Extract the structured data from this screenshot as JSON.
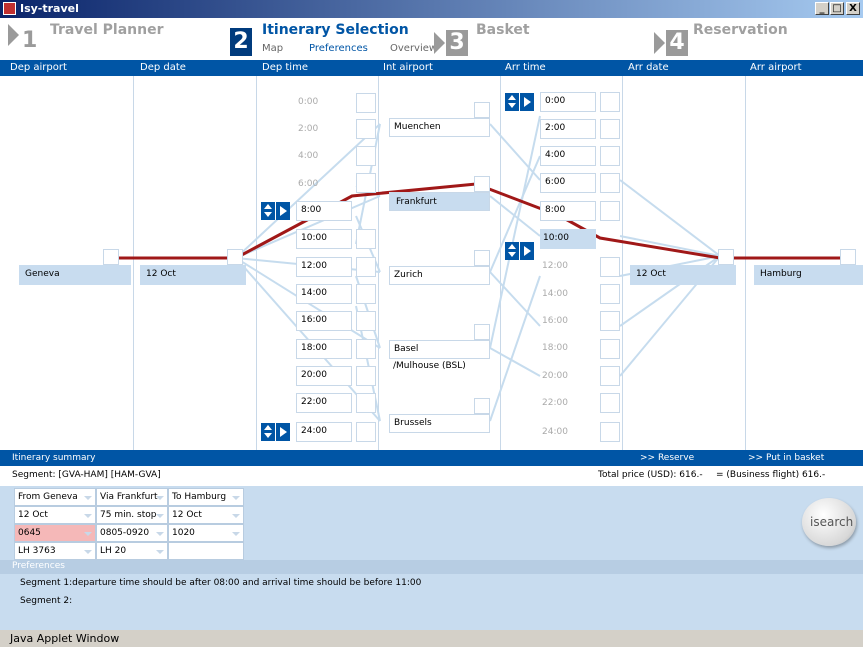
{
  "window": {
    "title": "Isy-travel",
    "minimize": "_",
    "maximize": "□",
    "close": "X"
  },
  "steps": {
    "s1": {
      "num": "1",
      "title": "Travel Planner"
    },
    "s2": {
      "num": "2",
      "title": "Itinerary Selection",
      "subs": [
        "Map",
        "Preferences",
        "Overview"
      ]
    },
    "s3": {
      "num": "3",
      "title": "Basket"
    },
    "s4": {
      "num": "4",
      "title": "Reservation"
    }
  },
  "columns": [
    "Dep airport",
    "Dep date",
    "Dep time",
    "Int airport",
    "Arr time",
    "Arr date",
    "Arr airport"
  ],
  "dep_airport": "Geneva",
  "dep_date": "12 Oct",
  "dep_times": [
    "0:00",
    "2:00",
    "4:00",
    "6:00",
    "8:00",
    "10:00",
    "12:00",
    "14:00",
    "16:00",
    "18:00",
    "20:00",
    "22:00",
    "24:00"
  ],
  "int_airports": [
    "Muenchen",
    "Frankfurt",
    "Zurich",
    "Basel",
    "/Mulhouse (BSL)",
    "Brussels"
  ],
  "arr_times": [
    "0:00",
    "2:00",
    "4:00",
    "6:00",
    "8:00",
    "10:00",
    "12:00",
    "14:00",
    "16:00",
    "18:00",
    "20:00",
    "22:00",
    "24:00"
  ],
  "arr_date": "12 Oct",
  "arr_airport": "Hamburg",
  "summary": {
    "title": "Itinerary summary",
    "reserve": ">> Reserve",
    "basket": ">> Put in basket",
    "segment": "Segment: [GVA-HAM] [HAM-GVA]",
    "total": "Total price (USD): 616.-",
    "eq": "= (Business flight) 616.-",
    "table": [
      [
        "From Geneva",
        "Via Frankfurt",
        "To Hamburg"
      ],
      [
        "12 Oct",
        "75 min. stop",
        "12 Oct"
      ],
      [
        "0645",
        "0805-0920",
        "1020"
      ],
      [
        "LH 3763",
        "LH 20",
        ""
      ]
    ],
    "search": "isearch"
  },
  "preferences": {
    "title": "Preferences",
    "line1": "Segment 1:departure time should be after 08:00 and arrival time should be before 11:00",
    "line2": "Segment 2:"
  },
  "status": "Java Applet Window",
  "colors": {
    "header": "#0055a5",
    "route": "#a01818",
    "selected": "#c8dcef"
  }
}
